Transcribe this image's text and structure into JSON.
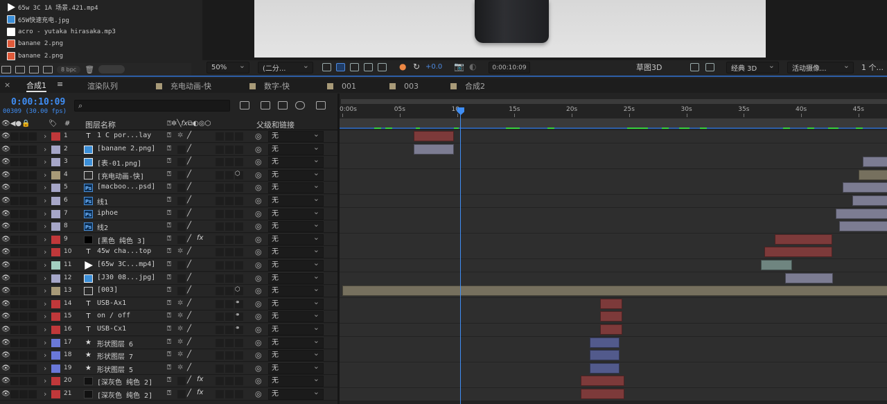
{
  "project": {
    "items": [
      {
        "name": "65w 3C 1A 场景.421.mp4",
        "type": "vid"
      },
      {
        "name": "65W快速充电.jpg",
        "type": "img"
      },
      {
        "name": "acro - yutaka hirasaka.mp3",
        "type": "aud"
      },
      {
        "name": "banane 2.png",
        "type": "png"
      },
      {
        "name": "banane 2.png",
        "type": "png"
      }
    ],
    "bpc": "8 bpc"
  },
  "viewer": {
    "zoom": "50%",
    "resolution": "(二分...",
    "exposure": "+0.0",
    "time": "0:00:10:09",
    "draft3d": "草图3D",
    "renderer": "经典 3D",
    "camera": "活动摄像...",
    "views": "1 个..."
  },
  "tabs": [
    {
      "label": "合成1",
      "color": "",
      "active": true
    },
    {
      "label": "渲染队列",
      "color": "",
      "active": false
    },
    {
      "label": "充电动画-快",
      "color": "#a89a78",
      "active": false
    },
    {
      "label": "数字-快",
      "color": "#a89a78",
      "active": false
    },
    {
      "label": "001",
      "color": "#a89a78",
      "active": false
    },
    {
      "label": "003",
      "color": "#a89a78",
      "active": false
    },
    {
      "label": "合成2",
      "color": "#a89a78",
      "active": false
    }
  ],
  "timeline": {
    "timecode": "0:00:10:09",
    "frameinfo": "00309 (30.00 fps)",
    "search_placeholder": "",
    "columns": {
      "source": "图层名称",
      "parent": "父级和链接"
    },
    "ruler": [
      "0:00s",
      "05s",
      "10s",
      "15s",
      "20s",
      "25s",
      "30s",
      "35s",
      "40s",
      "45s"
    ],
    "current_seconds": 10.3
  },
  "layers": [
    {
      "num": "1",
      "type": "T",
      "name": "1 C por...lay",
      "label": "#c0383a",
      "sw": "text",
      "parent": "无",
      "bar": [
        6.2,
        9.7
      ],
      "bar_color": "#7d3a3a"
    },
    {
      "num": "2",
      "type": "img",
      "name": "[banane 2.png]",
      "label": "#a6a6c8",
      "sw": "basic",
      "parent": "无",
      "bar": [
        6.2,
        9.7
      ],
      "bar_color": "#7c7c92"
    },
    {
      "num": "3",
      "type": "img",
      "name": "[表-01.png]",
      "label": "#a6a6c8",
      "sw": "basic",
      "parent": "无",
      "bar": [
        45.4,
        48
      ],
      "bar_color": "#7c7c92"
    },
    {
      "num": "4",
      "type": "pre",
      "name": "[充电动画-快]",
      "label": "#a89a78",
      "sw": "pre",
      "parent": "无",
      "bar": [
        45,
        48
      ],
      "bar_color": "#76705e"
    },
    {
      "num": "5",
      "type": "ps",
      "name": "[macboo...psd]",
      "label": "#a6a6c8",
      "sw": "basic",
      "parent": "无",
      "bar": [
        43.6,
        48
      ],
      "bar_color": "#7c7c92"
    },
    {
      "num": "6",
      "type": "ps",
      "name": "线1",
      "label": "#a6a6c8",
      "sw": "basic",
      "parent": "无",
      "bar": [
        44.5,
        48
      ],
      "bar_color": "#7c7c92"
    },
    {
      "num": "7",
      "type": "ps",
      "name": "iphoe",
      "label": "#a6a6c8",
      "sw": "basic",
      "parent": "无",
      "bar": [
        43,
        48
      ],
      "bar_color": "#7c7c92"
    },
    {
      "num": "8",
      "type": "ps",
      "name": "线2",
      "label": "#a6a6c8",
      "sw": "basic",
      "parent": "无",
      "bar": [
        43.3,
        48
      ],
      "bar_color": "#7c7c92"
    },
    {
      "num": "9",
      "type": "solid",
      "name": "[黑色 纯色 3]",
      "label": "#c0383a",
      "sw": "fx",
      "parent": "无",
      "bar": [
        37.7,
        42.7
      ],
      "bar_color": "#7d3a3a"
    },
    {
      "num": "10",
      "type": "T",
      "name": "45w cha...top",
      "label": "#c0383a",
      "sw": "text",
      "parent": "无",
      "bar": [
        36.8,
        42.7
      ],
      "bar_color": "#7d3a3a"
    },
    {
      "num": "11",
      "type": "vid",
      "name": "[65w 3C...mp4]",
      "label": "#a4cfc0",
      "sw": "basic",
      "parent": "无",
      "bar": [
        36.5,
        39.2
      ],
      "bar_color": "#6f8580"
    },
    {
      "num": "12",
      "type": "img",
      "name": "[J30 08...jpg]",
      "label": "#a6a6c8",
      "sw": "basic",
      "parent": "无",
      "bar": [
        38.6,
        42.8
      ],
      "bar_color": "#7c7c92"
    },
    {
      "num": "13",
      "type": "pre",
      "name": "[003]",
      "label": "#a89a78",
      "sw": "pre",
      "parent": "无",
      "bar": [
        0,
        48
      ],
      "bar_color": "#76705e"
    },
    {
      "num": "14",
      "type": "T",
      "name": "USB-Ax1",
      "label": "#c0383a",
      "sw": "text3d",
      "parent": "无",
      "bar": [
        22.5,
        24.4
      ],
      "bar_color": "#7d3a3a"
    },
    {
      "num": "15",
      "type": "T",
      "name": "on / off",
      "label": "#c0383a",
      "sw": "text3d",
      "parent": "无",
      "bar": [
        22.5,
        24.4
      ],
      "bar_color": "#7d3a3a"
    },
    {
      "num": "16",
      "type": "T",
      "name": "USB-Cx1",
      "label": "#c0383a",
      "sw": "text3d",
      "parent": "无",
      "bar": [
        22.5,
        24.4
      ],
      "bar_color": "#7d3a3a"
    },
    {
      "num": "17",
      "type": "star",
      "name": "形状图层 6",
      "label": "#6a78d8",
      "sw": "text",
      "parent": "无",
      "bar": [
        21.6,
        24.2
      ],
      "bar_color": "#525a8c"
    },
    {
      "num": "18",
      "type": "star",
      "name": "形状图层 7",
      "label": "#6a78d8",
      "sw": "text",
      "parent": "无",
      "bar": [
        21.6,
        24.2
      ],
      "bar_color": "#525a8c"
    },
    {
      "num": "19",
      "type": "star",
      "name": "形状图层 5",
      "label": "#6a78d8",
      "sw": "text",
      "parent": "无",
      "bar": [
        21.6,
        24.2
      ],
      "bar_color": "#525a8c"
    },
    {
      "num": "20",
      "type": "solid2",
      "name": "[深灰色 纯色 2]",
      "label": "#c0383a",
      "sw": "fx",
      "parent": "无",
      "bar": [
        20.8,
        24.6
      ],
      "bar_color": "#7d3a3a"
    },
    {
      "num": "21",
      "type": "solid2",
      "name": "[深灰色 纯色 2]",
      "label": "#c0383a",
      "sw": "fx",
      "parent": "无",
      "bar": [
        20.8,
        24.6
      ],
      "bar_color": "#7d3a3a"
    }
  ]
}
